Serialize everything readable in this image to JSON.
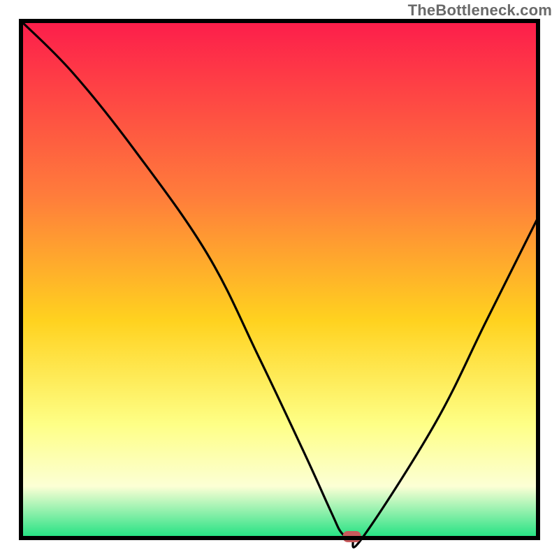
{
  "watermark": "TheBottleneck.com",
  "chart_data": {
    "type": "line",
    "title": "",
    "xlabel": "",
    "ylabel": "",
    "xlim": [
      0,
      100
    ],
    "ylim": [
      0,
      100
    ],
    "curve": {
      "name": "bottleneck-curve",
      "x": [
        0,
        10,
        22,
        36,
        46,
        55,
        60,
        62,
        64,
        66,
        80,
        90,
        100
      ],
      "y": [
        100,
        90,
        75,
        55,
        35,
        16,
        5,
        1,
        0,
        0,
        22,
        42,
        62
      ]
    },
    "marker": {
      "name": "optimal-point",
      "x": 64,
      "y": 0,
      "color": "#c95b5d"
    },
    "background_gradient": {
      "top": "#fd1d4b",
      "mid1": "#ff7d3b",
      "mid2": "#ffd21f",
      "mid3": "#feff86",
      "mid4": "#fcffd5",
      "bottom": "#1fe181"
    },
    "plot_border_color": "#000000",
    "plot_border_width": 6
  }
}
